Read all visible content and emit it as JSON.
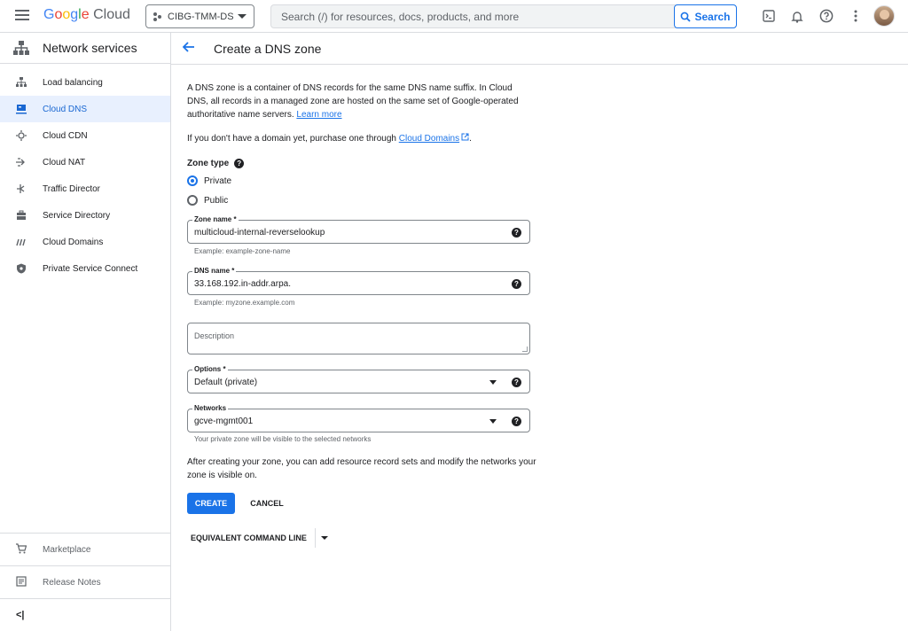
{
  "topbar": {
    "logo_google": "Google",
    "logo_cloud": "Cloud",
    "project": "CIBG-TMM-DS",
    "search_placeholder": "Search (/) for resources, docs, products, and more",
    "search_button": "Search"
  },
  "sidebar": {
    "title": "Network services",
    "items": [
      {
        "label": "Load balancing",
        "icon": "load-balancing-icon"
      },
      {
        "label": "Cloud DNS",
        "icon": "dns-icon",
        "active": true
      },
      {
        "label": "Cloud CDN",
        "icon": "cdn-icon"
      },
      {
        "label": "Cloud NAT",
        "icon": "nat-icon"
      },
      {
        "label": "Traffic Director",
        "icon": "traffic-director-icon"
      },
      {
        "label": "Service Directory",
        "icon": "service-directory-icon"
      },
      {
        "label": "Cloud Domains",
        "icon": "domains-icon"
      },
      {
        "label": "Private Service Connect",
        "icon": "shield-icon"
      }
    ],
    "marketplace": "Marketplace",
    "release_notes": "Release Notes",
    "collapse": "<|"
  },
  "page": {
    "title": "Create a DNS zone",
    "description": "A DNS zone is a container of DNS records for the same DNS name suffix. In Cloud DNS, all records in a managed zone are hosted on the same set of Google-operated authoritative name servers.",
    "learn_more": "Learn more",
    "purchase_text": "If you don't have a domain yet, purchase one through",
    "purchase_link": "Cloud Domains",
    "purchase_end": ".",
    "zone_type_label": "Zone type",
    "zone_type_options": [
      "Private",
      "Public"
    ],
    "zone_type_selected": "Private",
    "zone_name": {
      "label": "Zone name *",
      "value": "multicloud-internal-reverselookup",
      "hint": "Example: example-zone-name"
    },
    "dns_name": {
      "label": "DNS name *",
      "value": "33.168.192.in-addr.arpa.",
      "hint": "Example: myzone.example.com"
    },
    "description_field": {
      "placeholder": "Description"
    },
    "options": {
      "label": "Options *",
      "value": "Default (private)"
    },
    "networks": {
      "label": "Networks",
      "value": "gcve-mgmt001",
      "hint": "Your private zone will be visible to the selected networks"
    },
    "after_text": "After creating your zone, you can add resource record sets and modify the networks your zone is visible on.",
    "create_button": "CREATE",
    "cancel_button": "CANCEL",
    "equivalent_button": "EQUIVALENT COMMAND LINE"
  },
  "colors": {
    "accent": "#1a73e8",
    "active_bg": "#e8f0fe"
  }
}
